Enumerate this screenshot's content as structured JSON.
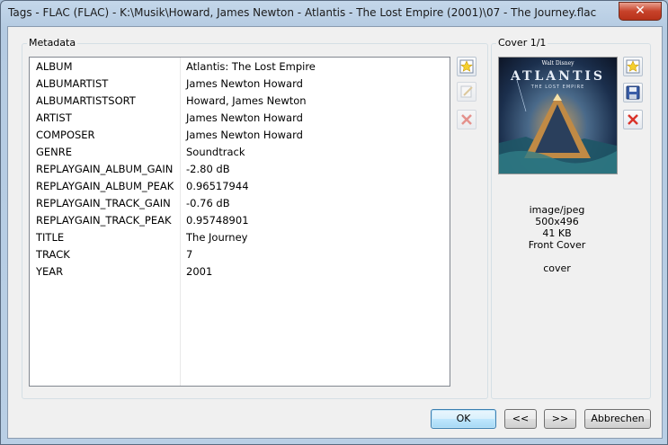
{
  "window": {
    "title": "Tags - FLAC (FLAC) - K:\\Musik\\Howard, James Newton - Atlantis - The Lost Empire (2001)\\07 - The Journey.flac",
    "close_glyph": "✕"
  },
  "metadata": {
    "label": "Metadata",
    "tags": [
      {
        "key": "ALBUM",
        "value": "Atlantis: The Lost Empire"
      },
      {
        "key": "ALBUMARTIST",
        "value": "James Newton Howard"
      },
      {
        "key": "ALBUMARTISTSORT",
        "value": "Howard, James Newton"
      },
      {
        "key": "ARTIST",
        "value": "James Newton Howard"
      },
      {
        "key": "COMPOSER",
        "value": "James Newton Howard"
      },
      {
        "key": "GENRE",
        "value": "Soundtrack"
      },
      {
        "key": "REPLAYGAIN_ALBUM_GAIN",
        "value": "-2.80 dB"
      },
      {
        "key": "REPLAYGAIN_ALBUM_PEAK",
        "value": "0.96517944"
      },
      {
        "key": "REPLAYGAIN_TRACK_GAIN",
        "value": "-0.76 dB"
      },
      {
        "key": "REPLAYGAIN_TRACK_PEAK",
        "value": "0.95748901"
      },
      {
        "key": "TITLE",
        "value": "The Journey"
      },
      {
        "key": "TRACK",
        "value": "7"
      },
      {
        "key": "YEAR",
        "value": "2001"
      }
    ]
  },
  "cover": {
    "label": "Cover 1/1",
    "art": {
      "brand": "Walt Disney",
      "title": "ATLANTIS",
      "subtitle": "THE LOST EMPIRE"
    },
    "info": {
      "mime": "image/jpeg",
      "dimensions": "500x496",
      "size": "41 KB",
      "type": "Front Cover",
      "description": "cover"
    }
  },
  "buttons": {
    "ok": "OK",
    "prev": "<<",
    "next": ">>",
    "cancel": "Abbrechen"
  },
  "colors": {
    "accent_red": "#d9342b",
    "accent_blue": "#3a5ea8",
    "star_yellow": "#f5d02e"
  }
}
